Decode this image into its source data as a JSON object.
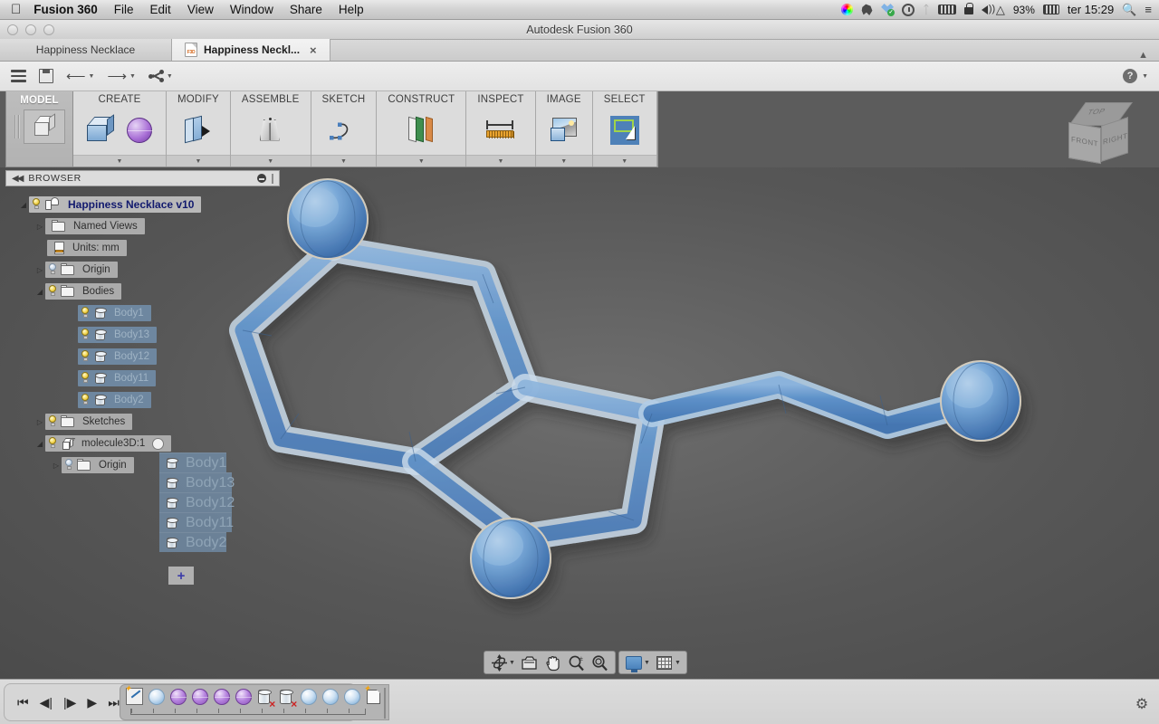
{
  "macos_menubar": {
    "apple_logo": "apple-icon",
    "app_name": "Fusion 360",
    "menus": [
      "File",
      "Edit",
      "View",
      "Window",
      "Share",
      "Help"
    ],
    "status": {
      "battery_percent": "93%",
      "clock": "ter 15:29",
      "icons": [
        "colorwheel-icon",
        "evernote-icon",
        "dropbox-icon",
        "timemachine-icon",
        "bluetooth-icon",
        "battery-icon",
        "lock-icon",
        "volume-icon",
        "wifi-icon",
        "power-icon",
        "spotlight-search-icon",
        "notification-center-icon"
      ]
    }
  },
  "window": {
    "title": "Autodesk Fusion 360",
    "controls": [
      "close",
      "minimize",
      "zoom"
    ]
  },
  "tabs": {
    "items": [
      {
        "label": "Happiness Necklace",
        "active": false,
        "closable": false
      },
      {
        "label": "Happiness Neckl...",
        "active": true,
        "closable": true,
        "icon": "f3d-file-icon",
        "icon_text": "F3D"
      }
    ],
    "collapse_icon": "chevron-up-icon"
  },
  "quick_access": {
    "menu_icon": "hamburger-menu-icon",
    "save_icon": "save-icon",
    "undo_icon": "undo-icon",
    "redo_icon": "redo-icon",
    "share_icon": "share-icon",
    "help_icon": "help-icon"
  },
  "ribbon": {
    "workspace": {
      "label": "MODEL",
      "icon": "model-cube-icon"
    },
    "panels": [
      {
        "label": "CREATE",
        "icons": [
          "box-icon",
          "sphere-icon"
        ],
        "has_dropdown": true
      },
      {
        "label": "MODIFY",
        "icons": [
          "press-pull-icon"
        ],
        "has_dropdown": true
      },
      {
        "label": "ASSEMBLE",
        "icons": [
          "joint-icon"
        ],
        "has_dropdown": true
      },
      {
        "label": "SKETCH",
        "icons": [
          "spline-icon"
        ],
        "has_dropdown": true
      },
      {
        "label": "CONSTRUCT",
        "icons": [
          "offset-plane-icon"
        ],
        "has_dropdown": true
      },
      {
        "label": "INSPECT",
        "icons": [
          "measure-icon"
        ],
        "has_dropdown": true
      },
      {
        "label": "IMAGE",
        "icons": [
          "canvas-image-icon"
        ],
        "has_dropdown": true
      },
      {
        "label": "SELECT",
        "icons": [
          "window-select-icon"
        ],
        "has_dropdown": true,
        "selected": true
      }
    ]
  },
  "browser": {
    "header": "BROWSER",
    "collapse_icon": "collapse-left-icon",
    "minimize_icon": "minimize-icon",
    "grip_icon": "grip-icon",
    "tree": [
      {
        "label": "Happiness Necklace v10",
        "indent": 0,
        "icon": "document-root-icon",
        "bulb": "on",
        "expander": "open",
        "style": "root"
      },
      {
        "label": "Named Views",
        "indent": 1,
        "icon": "folder-icon",
        "bulb": "none",
        "expander": "closed",
        "style": "plain"
      },
      {
        "label": "Units: mm",
        "indent": 1,
        "icon": "units-icon",
        "bulb": "none",
        "expander": "none",
        "style": "plain"
      },
      {
        "label": "Origin",
        "indent": 1,
        "icon": "folder-icon",
        "bulb": "off",
        "expander": "closed",
        "style": "plain"
      },
      {
        "label": "Bodies",
        "indent": 1,
        "icon": "folder-icon",
        "bulb": "on",
        "expander": "open",
        "style": "plain"
      },
      {
        "label": "Body1",
        "indent": 2,
        "icon": "body-icon",
        "bulb": "on",
        "expander": "none",
        "style": "sel"
      },
      {
        "label": "Body13",
        "indent": 2,
        "icon": "body-icon",
        "bulb": "on",
        "expander": "none",
        "style": "sel"
      },
      {
        "label": "Body12",
        "indent": 2,
        "icon": "body-icon",
        "bulb": "on",
        "expander": "none",
        "style": "sel"
      },
      {
        "label": "Body11",
        "indent": 2,
        "icon": "body-icon",
        "bulb": "on",
        "expander": "none",
        "style": "sel"
      },
      {
        "label": "Body2",
        "indent": 2,
        "icon": "body-icon",
        "bulb": "on",
        "expander": "none",
        "style": "sel"
      },
      {
        "label": "Sketches",
        "indent": 1,
        "icon": "folder-icon",
        "bulb": "on",
        "expander": "closed",
        "style": "plain"
      },
      {
        "label": "molecule3D:1",
        "indent": 1,
        "icon": "component-icon",
        "bulb": "on",
        "expander": "open",
        "style": "plain",
        "radio": true
      },
      {
        "label": "Origin",
        "indent": 2,
        "icon": "folder-icon",
        "bulb": "off",
        "expander": "closed",
        "style": "plain"
      }
    ],
    "drag_ghost": {
      "items": [
        "Body1",
        "Body13",
        "Body12",
        "Body11",
        "Body2"
      ],
      "drop_indicator": "+"
    }
  },
  "viewport": {
    "view_cube": {
      "faces": [
        "TOP",
        "FRONT",
        "RIGHT"
      ]
    },
    "model_name": "molecule3D",
    "model_description": "serotonin ball-and-stick molecule, translucent blue"
  },
  "navigation_bar": {
    "buttons": [
      {
        "name": "orbit",
        "icon": "orbit-icon",
        "has_caret": true
      },
      {
        "name": "look-at",
        "icon": "look-at-icon",
        "has_caret": false
      },
      {
        "name": "pan",
        "icon": "pan-hand-icon",
        "has_caret": false
      },
      {
        "name": "zoom",
        "icon": "zoom-icon",
        "has_caret": false
      },
      {
        "name": "fit",
        "icon": "fit-icon",
        "has_caret": false
      }
    ],
    "display_group": [
      {
        "name": "display-settings",
        "icon": "display-settings-icon",
        "has_caret": true
      },
      {
        "name": "grid-and-snaps",
        "icon": "grid-snaps-icon",
        "has_caret": true
      }
    ]
  },
  "timeline": {
    "playback": [
      "jump-start-icon",
      "step-back-icon",
      "step-forward-icon",
      "play-icon",
      "jump-end-icon"
    ],
    "features": [
      {
        "icon": "sketch-icon",
        "type": "sketch"
      },
      {
        "icon": "sphere-icon",
        "type": "blue"
      },
      {
        "icon": "sphere-icon",
        "type": "purple"
      },
      {
        "icon": "sphere-icon",
        "type": "purple"
      },
      {
        "icon": "sphere-icon",
        "type": "purple"
      },
      {
        "icon": "sphere-icon",
        "type": "purple"
      },
      {
        "icon": "delete-body-icon",
        "type": "cyl-x"
      },
      {
        "icon": "delete-body-icon",
        "type": "cyl-x"
      },
      {
        "icon": "sphere-icon",
        "type": "blue"
      },
      {
        "icon": "sphere-icon",
        "type": "blue"
      },
      {
        "icon": "sphere-icon",
        "type": "blue"
      },
      {
        "icon": "new-component-icon",
        "type": "component"
      }
    ],
    "marker_icon": "timeline-marker-icon",
    "settings_icon": "gear-icon"
  }
}
